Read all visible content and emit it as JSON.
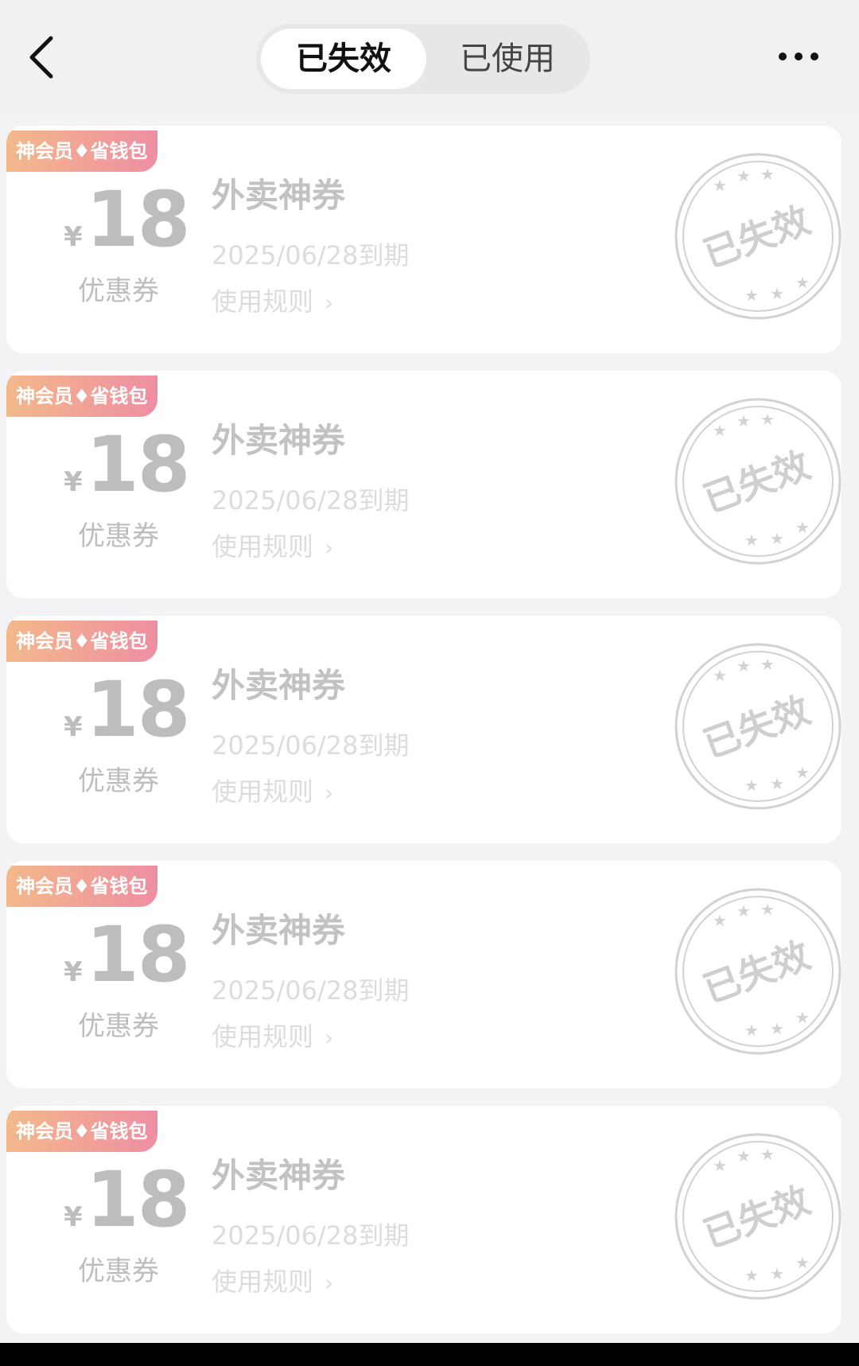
{
  "header": {
    "tabs": [
      {
        "label": "已失效",
        "active": true
      },
      {
        "label": "已使用",
        "active": false
      }
    ]
  },
  "coupons": [
    {
      "badge": "神会员♦省钱包",
      "currency": "¥",
      "amount": "18",
      "amount_label": "优惠券",
      "title": "外卖神券",
      "expire": "2025/06/28到期",
      "rules_label": "使用规则",
      "stamp": "已失效"
    },
    {
      "badge": "神会员♦省钱包",
      "currency": "¥",
      "amount": "18",
      "amount_label": "优惠券",
      "title": "外卖神券",
      "expire": "2025/06/28到期",
      "rules_label": "使用规则",
      "stamp": "已失效"
    },
    {
      "badge": "神会员♦省钱包",
      "currency": "¥",
      "amount": "18",
      "amount_label": "优惠券",
      "title": "外卖神券",
      "expire": "2025/06/28到期",
      "rules_label": "使用规则",
      "stamp": "已失效"
    },
    {
      "badge": "神会员♦省钱包",
      "currency": "¥",
      "amount": "18",
      "amount_label": "优惠券",
      "title": "外卖神券",
      "expire": "2025/06/28到期",
      "rules_label": "使用规则",
      "stamp": "已失效"
    },
    {
      "badge": "神会员♦省钱包",
      "currency": "¥",
      "amount": "18",
      "amount_label": "优惠券",
      "title": "外卖神券",
      "expire": "2025/06/28到期",
      "rules_label": "使用规则",
      "stamp": "已失效"
    }
  ],
  "icons": {
    "back": "chevron-left-icon",
    "more": "more-horizontal-icon",
    "rules": "chevron-right-icon"
  },
  "colors": {
    "badge_start": "#f3b98a",
    "badge_end": "#ef8ea3",
    "muted_text": "#bdbdbd",
    "stamp": "#d2d2d2"
  }
}
